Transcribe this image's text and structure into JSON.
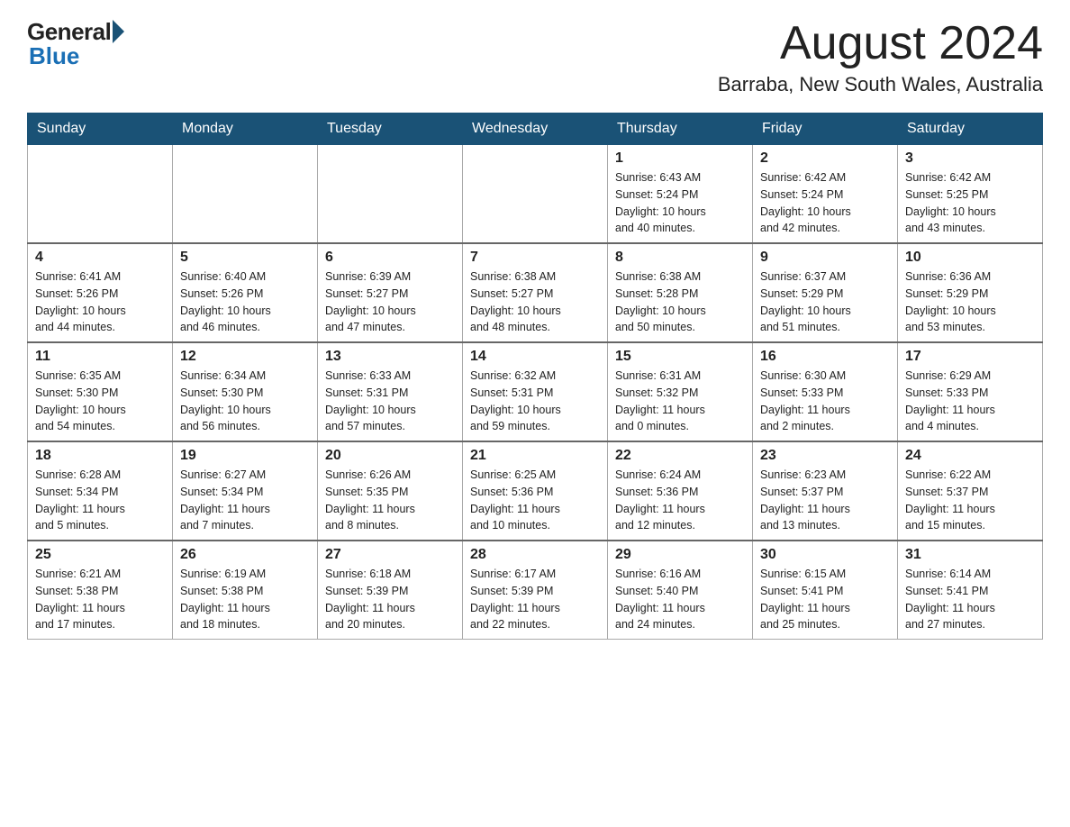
{
  "header": {
    "logo_general": "General",
    "logo_blue": "Blue",
    "title": "August 2024",
    "subtitle": "Barraba, New South Wales, Australia"
  },
  "calendar": {
    "days_of_week": [
      "Sunday",
      "Monday",
      "Tuesday",
      "Wednesday",
      "Thursday",
      "Friday",
      "Saturday"
    ],
    "weeks": [
      {
        "days": [
          {
            "number": "",
            "info": ""
          },
          {
            "number": "",
            "info": ""
          },
          {
            "number": "",
            "info": ""
          },
          {
            "number": "",
            "info": ""
          },
          {
            "number": "1",
            "info": "Sunrise: 6:43 AM\nSunset: 5:24 PM\nDaylight: 10 hours\nand 40 minutes."
          },
          {
            "number": "2",
            "info": "Sunrise: 6:42 AM\nSunset: 5:24 PM\nDaylight: 10 hours\nand 42 minutes."
          },
          {
            "number": "3",
            "info": "Sunrise: 6:42 AM\nSunset: 5:25 PM\nDaylight: 10 hours\nand 43 minutes."
          }
        ]
      },
      {
        "days": [
          {
            "number": "4",
            "info": "Sunrise: 6:41 AM\nSunset: 5:26 PM\nDaylight: 10 hours\nand 44 minutes."
          },
          {
            "number": "5",
            "info": "Sunrise: 6:40 AM\nSunset: 5:26 PM\nDaylight: 10 hours\nand 46 minutes."
          },
          {
            "number": "6",
            "info": "Sunrise: 6:39 AM\nSunset: 5:27 PM\nDaylight: 10 hours\nand 47 minutes."
          },
          {
            "number": "7",
            "info": "Sunrise: 6:38 AM\nSunset: 5:27 PM\nDaylight: 10 hours\nand 48 minutes."
          },
          {
            "number": "8",
            "info": "Sunrise: 6:38 AM\nSunset: 5:28 PM\nDaylight: 10 hours\nand 50 minutes."
          },
          {
            "number": "9",
            "info": "Sunrise: 6:37 AM\nSunset: 5:29 PM\nDaylight: 10 hours\nand 51 minutes."
          },
          {
            "number": "10",
            "info": "Sunrise: 6:36 AM\nSunset: 5:29 PM\nDaylight: 10 hours\nand 53 minutes."
          }
        ]
      },
      {
        "days": [
          {
            "number": "11",
            "info": "Sunrise: 6:35 AM\nSunset: 5:30 PM\nDaylight: 10 hours\nand 54 minutes."
          },
          {
            "number": "12",
            "info": "Sunrise: 6:34 AM\nSunset: 5:30 PM\nDaylight: 10 hours\nand 56 minutes."
          },
          {
            "number": "13",
            "info": "Sunrise: 6:33 AM\nSunset: 5:31 PM\nDaylight: 10 hours\nand 57 minutes."
          },
          {
            "number": "14",
            "info": "Sunrise: 6:32 AM\nSunset: 5:31 PM\nDaylight: 10 hours\nand 59 minutes."
          },
          {
            "number": "15",
            "info": "Sunrise: 6:31 AM\nSunset: 5:32 PM\nDaylight: 11 hours\nand 0 minutes."
          },
          {
            "number": "16",
            "info": "Sunrise: 6:30 AM\nSunset: 5:33 PM\nDaylight: 11 hours\nand 2 minutes."
          },
          {
            "number": "17",
            "info": "Sunrise: 6:29 AM\nSunset: 5:33 PM\nDaylight: 11 hours\nand 4 minutes."
          }
        ]
      },
      {
        "days": [
          {
            "number": "18",
            "info": "Sunrise: 6:28 AM\nSunset: 5:34 PM\nDaylight: 11 hours\nand 5 minutes."
          },
          {
            "number": "19",
            "info": "Sunrise: 6:27 AM\nSunset: 5:34 PM\nDaylight: 11 hours\nand 7 minutes."
          },
          {
            "number": "20",
            "info": "Sunrise: 6:26 AM\nSunset: 5:35 PM\nDaylight: 11 hours\nand 8 minutes."
          },
          {
            "number": "21",
            "info": "Sunrise: 6:25 AM\nSunset: 5:36 PM\nDaylight: 11 hours\nand 10 minutes."
          },
          {
            "number": "22",
            "info": "Sunrise: 6:24 AM\nSunset: 5:36 PM\nDaylight: 11 hours\nand 12 minutes."
          },
          {
            "number": "23",
            "info": "Sunrise: 6:23 AM\nSunset: 5:37 PM\nDaylight: 11 hours\nand 13 minutes."
          },
          {
            "number": "24",
            "info": "Sunrise: 6:22 AM\nSunset: 5:37 PM\nDaylight: 11 hours\nand 15 minutes."
          }
        ]
      },
      {
        "days": [
          {
            "number": "25",
            "info": "Sunrise: 6:21 AM\nSunset: 5:38 PM\nDaylight: 11 hours\nand 17 minutes."
          },
          {
            "number": "26",
            "info": "Sunrise: 6:19 AM\nSunset: 5:38 PM\nDaylight: 11 hours\nand 18 minutes."
          },
          {
            "number": "27",
            "info": "Sunrise: 6:18 AM\nSunset: 5:39 PM\nDaylight: 11 hours\nand 20 minutes."
          },
          {
            "number": "28",
            "info": "Sunrise: 6:17 AM\nSunset: 5:39 PM\nDaylight: 11 hours\nand 22 minutes."
          },
          {
            "number": "29",
            "info": "Sunrise: 6:16 AM\nSunset: 5:40 PM\nDaylight: 11 hours\nand 24 minutes."
          },
          {
            "number": "30",
            "info": "Sunrise: 6:15 AM\nSunset: 5:41 PM\nDaylight: 11 hours\nand 25 minutes."
          },
          {
            "number": "31",
            "info": "Sunrise: 6:14 AM\nSunset: 5:41 PM\nDaylight: 11 hours\nand 27 minutes."
          }
        ]
      }
    ]
  }
}
